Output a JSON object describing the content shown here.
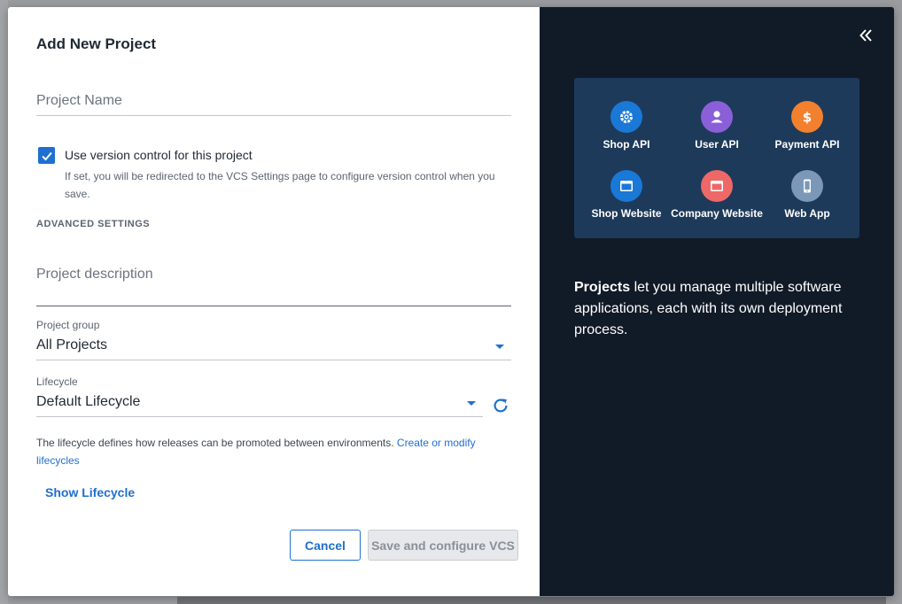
{
  "dialog": {
    "title": "Add New Project",
    "project_name_placeholder": "Project Name",
    "vcs_checkbox": {
      "checked": true,
      "label": "Use version control for this project",
      "help": "If set, you will be redirected to the VCS Settings page to configure version control when you save."
    },
    "advanced_heading": "ADVANCED SETTINGS",
    "description_placeholder": "Project description",
    "project_group": {
      "label": "Project group",
      "value": "All Projects"
    },
    "lifecycle": {
      "label": "Lifecycle",
      "value": "Default Lifecycle"
    },
    "lifecycle_help": "The lifecycle defines how releases can be promoted between environments. ",
    "lifecycle_link": "Create or modify lifecycles",
    "show_lifecycle": "Show Lifecycle",
    "buttons": {
      "cancel": "Cancel",
      "save": "Save and configure VCS"
    }
  },
  "info_panel": {
    "projects": [
      {
        "name": "Shop API",
        "icon": "gear-icon",
        "color": "#1a78d6"
      },
      {
        "name": "User API",
        "icon": "user-icon",
        "color": "#8b5fd8"
      },
      {
        "name": "Payment API",
        "icon": "dollar-icon",
        "color": "#f2802e"
      },
      {
        "name": "Shop Website",
        "icon": "browser-icon",
        "color": "#1a78d6"
      },
      {
        "name": "Company Website",
        "icon": "browser-icon",
        "color": "#ee6868"
      },
      {
        "name": "Web App",
        "icon": "mobile-icon",
        "color": "#7c98b8"
      }
    ],
    "blurb_strong": "Projects",
    "blurb_rest": " let you manage multiple software applications, each with its own deployment process."
  },
  "colors": {
    "accent": "#1f6fd0",
    "panel_bg": "#111a27",
    "card_bg": "#1d3a5a"
  }
}
